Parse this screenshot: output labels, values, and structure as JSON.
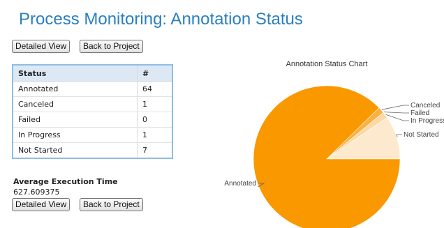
{
  "page": {
    "title": "Process Monitoring: Annotation Status"
  },
  "buttons": {
    "detailed_view": "Detailed View",
    "back_to_project": "Back to Project"
  },
  "table": {
    "headers": [
      "Status",
      "#"
    ],
    "rows": [
      {
        "status": "Annotated",
        "count": "64"
      },
      {
        "status": "Canceled",
        "count": "1"
      },
      {
        "status": "Failed",
        "count": "0"
      },
      {
        "status": "In Progress",
        "count": "1"
      },
      {
        "status": "Not Started",
        "count": "7"
      }
    ]
  },
  "execution": {
    "label": "Average Execution Time",
    "value": "627.609375"
  },
  "colors": {
    "title": "#2a7fc1",
    "table_border": "#8fbde3",
    "table_header_bg": "#dce9f5"
  },
  "chart_data": {
    "type": "pie",
    "title": "Annotation Status Chart",
    "categories": [
      "Annotated",
      "Canceled",
      "Failed",
      "In Progress",
      "Not Started"
    ],
    "values": [
      64,
      1,
      0,
      1,
      7
    ],
    "colors": [
      "#fa9800",
      "#fbb040",
      "#fcc878",
      "#fdd8a4",
      "#fde9cd"
    ]
  }
}
